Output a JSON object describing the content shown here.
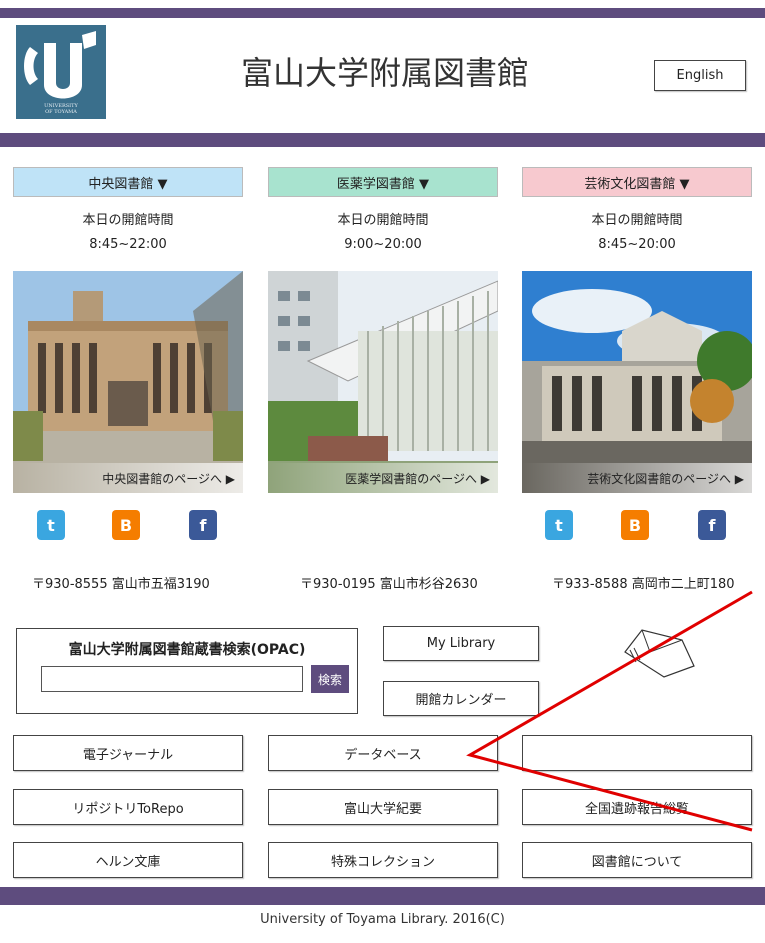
{
  "header": {
    "title": "富山大学附属図書館",
    "english_label": "English",
    "logo_text_line1": "UNIVERSITY",
    "logo_text_line2": "OF TOYAMA"
  },
  "libraries": [
    {
      "name": "中央図書館 ▼",
      "hours_label": "本日の開館時間",
      "hours": "8:45~22:00",
      "page_link": "中央図書館のページへ ▶",
      "address": "〒930-8555 富山市五福3190",
      "header_color": "#bfe3f7"
    },
    {
      "name": "医薬学図書館 ▼",
      "hours_label": "本日の開館時間",
      "hours": "9:00~20:00",
      "page_link": "医薬学図書館のページへ ▶",
      "address": "〒930-0195 富山市杉谷2630",
      "header_color": "#a8e3cf"
    },
    {
      "name": "芸術文化図書館 ▼",
      "hours_label": "本日の開館時間",
      "hours": "8:45~20:00",
      "page_link": "芸術文化図書館のページへ ▶",
      "address": "〒933-8588 高岡市二上町180",
      "header_color": "#f7c9cf"
    }
  ],
  "social": {
    "twitter_glyph": "t",
    "blogger_glyph": "B",
    "facebook_glyph": "f",
    "twitter_color": "#3aa6e0",
    "blogger_color": "#f57d00",
    "facebook_color": "#3b5998"
  },
  "opac": {
    "title": "富山大学附属図書館蔵書検索(OPAC)",
    "search_label": "検索",
    "input_value": ""
  },
  "side_buttons": {
    "my_library": "My Library",
    "calendar": "開館カレンダー"
  },
  "links": [
    "電子ジャーナル",
    "データベース",
    "リポジトリToRepo",
    "富山大学紀要",
    "全国遺跡報告総覧",
    "ヘルン文庫",
    "特殊コレクション",
    "図書館について"
  ],
  "footer": {
    "copyright": "University of Toyama Library. 2016(C)"
  },
  "colors": {
    "brand_bar": "#5e4c7e",
    "annotation_arrow": "#e00000"
  }
}
